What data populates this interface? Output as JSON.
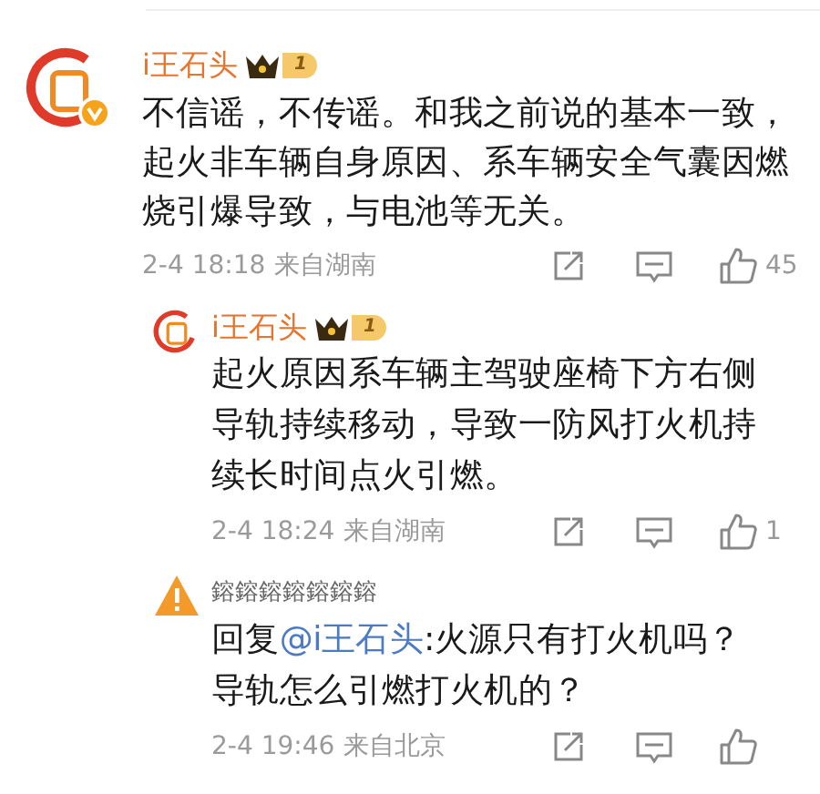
{
  "comment": {
    "author": "i王石头",
    "level": "1",
    "verified": true,
    "text": "不信谣，不传谣。和我之前说的基本一致，起火非车辆自身原因、系车辆安全气囊因燃烧引爆导致，与电池等无关。",
    "time": "2-4 18:18",
    "location": "来自湖南",
    "likes": "45"
  },
  "replies": [
    {
      "kind": "logo",
      "author": "i王石头",
      "level": "1",
      "text": "起火原因系车辆主驾驶座椅下方右侧导轨持续移动，导致一防风打火机持续长时间点火引燃。",
      "time": "2-4 18:24",
      "location": "来自湖南",
      "likes": "1"
    },
    {
      "kind": "warning",
      "author": "鎔鎔鎔鎔鎔鎔鎔",
      "prefix": "回复",
      "mention": "@i王石头",
      "text": ":火源只有打火机吗？导轨怎么引燃打火机的？",
      "time": "2-4 19:46",
      "location": "来自北京"
    }
  ]
}
